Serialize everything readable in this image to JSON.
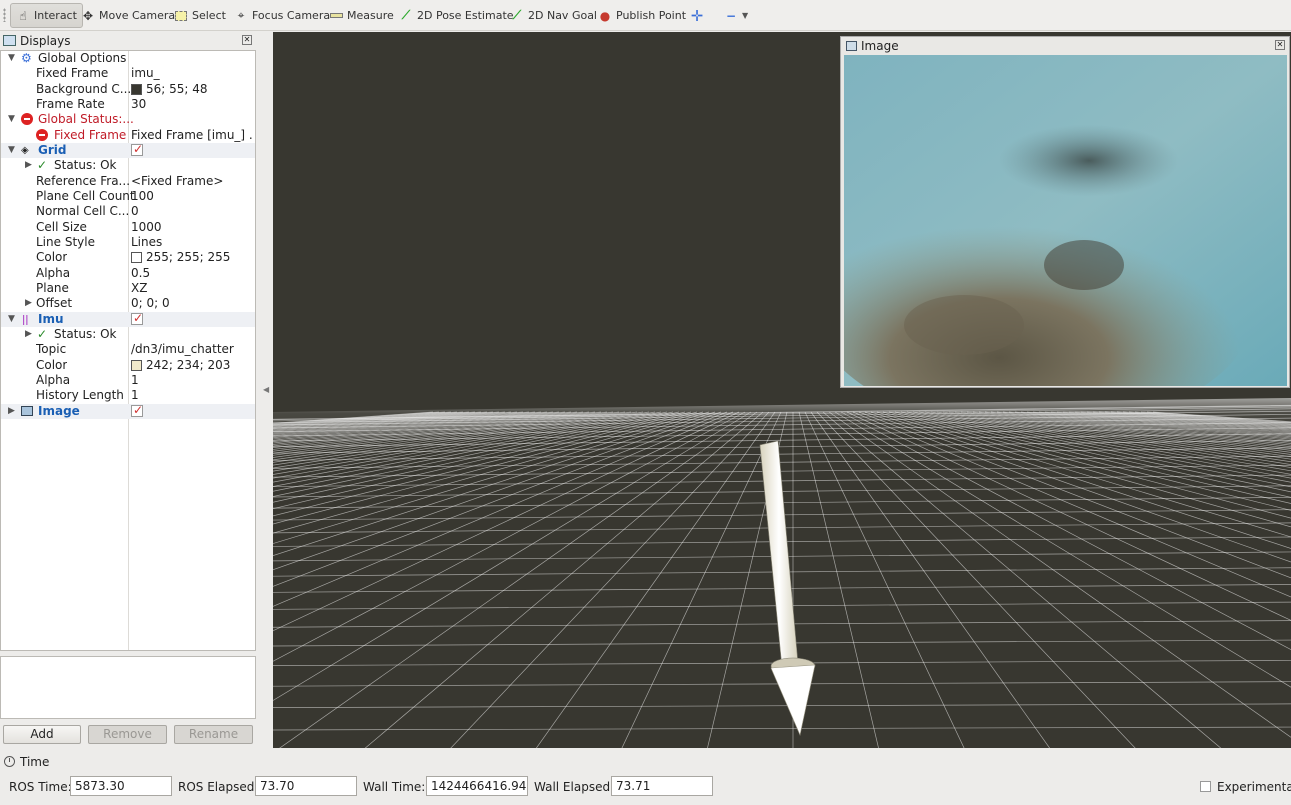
{
  "toolbar": {
    "buttons": [
      {
        "label": "Interact",
        "icon": "hand-icon"
      },
      {
        "label": "Move Camera",
        "icon": "move-camera-icon"
      },
      {
        "label": "Select",
        "icon": "select-box-icon"
      },
      {
        "label": "Focus Camera",
        "icon": "crosshair-icon"
      },
      {
        "label": "Measure",
        "icon": "ruler-icon"
      },
      {
        "label": "2D Pose Estimate",
        "icon": "green-arrow-icon"
      },
      {
        "label": "2D Nav Goal",
        "icon": "green-arrow-icon"
      },
      {
        "label": "Publish Point",
        "icon": "map-pin-icon"
      }
    ],
    "colors": {
      "pose_arrow": "#2eaa2e",
      "pin": "#c63a2e",
      "plus": "#3a6fd8"
    }
  },
  "displays": {
    "title": "Displays",
    "rows": [
      {
        "name": "Global Options",
        "value": ""
      },
      {
        "name": "Fixed Frame",
        "value": "imu_"
      },
      {
        "name": "Background C...",
        "value": "56; 55; 48",
        "swatch": "#383730"
      },
      {
        "name": "Frame Rate",
        "value": "30"
      },
      {
        "name": "Global Status:...",
        "value": ""
      },
      {
        "name": "Fixed Frame",
        "value": "Fixed Frame [imu_] ..."
      },
      {
        "name": "Grid",
        "value": ""
      },
      {
        "name": "Status: Ok",
        "value": ""
      },
      {
        "name": "Reference Fra...",
        "value": "<Fixed Frame>"
      },
      {
        "name": "Plane Cell Count",
        "value": "100"
      },
      {
        "name": "Normal Cell C...",
        "value": "0"
      },
      {
        "name": "Cell Size",
        "value": "1000"
      },
      {
        "name": "Line Style",
        "value": "Lines"
      },
      {
        "name": "Color",
        "value": "255; 255; 255",
        "swatch": "#ffffff"
      },
      {
        "name": "Alpha",
        "value": "0.5"
      },
      {
        "name": "Plane",
        "value": "XZ"
      },
      {
        "name": "Offset",
        "value": "0; 0; 0"
      },
      {
        "name": "Imu",
        "value": ""
      },
      {
        "name": "Status: Ok",
        "value": ""
      },
      {
        "name": "Topic",
        "value": "/dn3/imu_chatter"
      },
      {
        "name": "Color",
        "value": "242; 234; 203",
        "swatch": "#f2eacb"
      },
      {
        "name": "Alpha",
        "value": "1"
      },
      {
        "name": "History Length",
        "value": "1"
      },
      {
        "name": "Image",
        "value": ""
      }
    ],
    "buttons": {
      "add": "Add",
      "remove": "Remove",
      "rename": "Rename"
    }
  },
  "image_window": {
    "title": "Image"
  },
  "time": {
    "title": "Time",
    "ros_time_label": "ROS Time:",
    "ros_time": "5873.30",
    "ros_elapsed_label": "ROS Elapsed:",
    "ros_elapsed": "73.70",
    "wall_time_label": "Wall Time:",
    "wall_time": "1424466416.94",
    "wall_elapsed_label": "Wall Elapsed:",
    "wall_elapsed": "73.71",
    "experimental_label": "Experimental"
  }
}
